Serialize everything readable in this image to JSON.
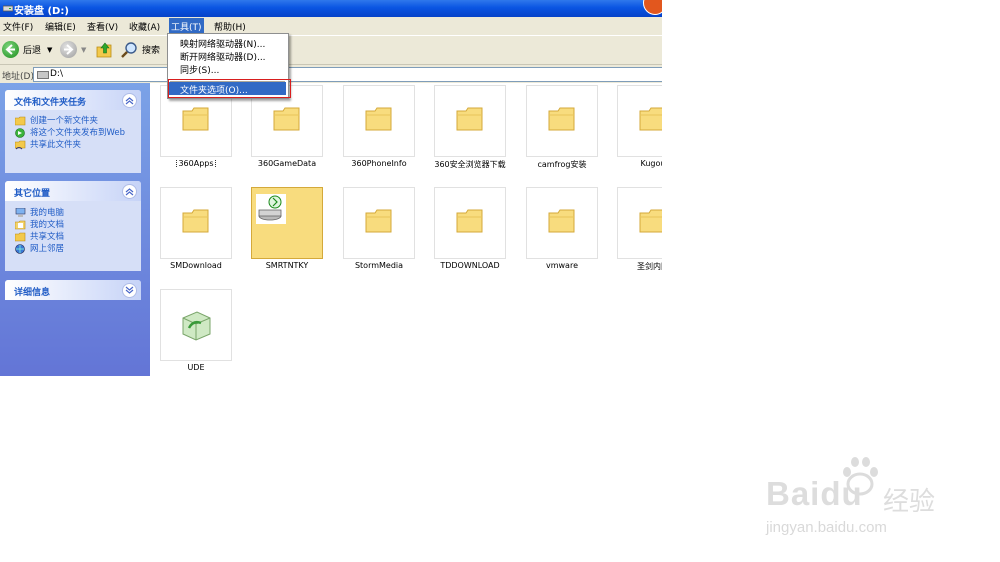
{
  "window": {
    "title": "安装盘 (D:)"
  },
  "menu": {
    "file": "文件(F)",
    "edit": "编辑(E)",
    "view": "查看(V)",
    "favorites": "收藏(A)",
    "tools": "工具(T)",
    "help": "帮助(H)"
  },
  "toolbar": {
    "back": "后退",
    "search": "搜索"
  },
  "address": {
    "label": "地址(D)",
    "value": "D:\\"
  },
  "tools_menu": {
    "items": [
      "映射网络驱动器(N)...",
      "断开网络驱动器(D)...",
      "同步(S)...",
      "文件夹选项(O)..."
    ]
  },
  "sidebar": {
    "tasks_title": "文件和文件夹任务",
    "tasks": [
      "创建一个新文件夹",
      "将这个文件夹发布到Web",
      "共享此文件夹"
    ],
    "places_title": "其它位置",
    "places": [
      "我的电脑",
      "我的文档",
      "共享文档",
      "网上邻居"
    ],
    "details_title": "详细信息"
  },
  "folders": [
    "360Apps",
    "360GameData",
    "360PhoneInfo",
    "360安全浏览器下载",
    "camfrog安装",
    "Kugou",
    "SMDownload",
    "SMRTNTKY",
    "StormMedia",
    "TDDOWNLOAD",
    "vmware",
    "圣剑内网",
    "UDE"
  ],
  "watermark": {
    "brand": "Baidu",
    "product": "经验",
    "url": "jingyan.baidu.com"
  },
  "colors": {
    "titlebar": "#0a55e2",
    "sidebar": "#6f8fe0",
    "highlight": "#316ac5",
    "redbox": "#d81e1e"
  }
}
